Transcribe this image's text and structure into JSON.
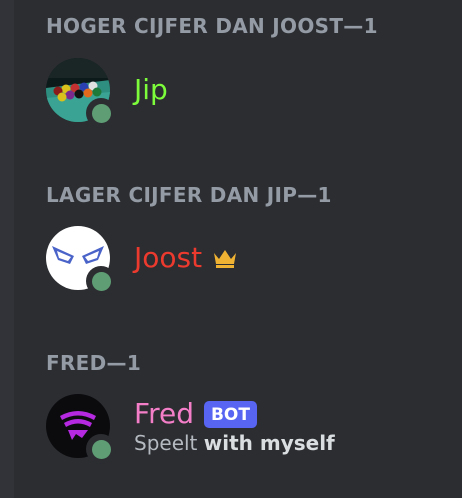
{
  "colors": {
    "background": "#2b2d31",
    "header_text": "#949ba4",
    "online_status": "#5f9d74",
    "jip_name": "#7cfc3a",
    "joost_name": "#ed3a2e",
    "fred_name": "#f47fc8",
    "bot_badge": "#5865f2",
    "crown": "#f0b232"
  },
  "groups": [
    {
      "header": "HOGER CIJFER DAN JOOST—1",
      "members": [
        {
          "name": "Jip",
          "avatar_icon": "billiard-balls-avatar",
          "status": "online"
        }
      ]
    },
    {
      "header": "LAGER CIJFER DAN JIP—1",
      "members": [
        {
          "name": "Joost",
          "avatar_icon": "angry-eyes-avatar",
          "status": "online",
          "badge_icon": "crown-icon"
        }
      ]
    },
    {
      "header": "FRED—1",
      "members": [
        {
          "name": "Fred",
          "avatar_icon": "purple-signal-avatar",
          "status": "online",
          "tag": "BOT",
          "activity_prefix": "Speelt",
          "activity_name": "with myself"
        }
      ]
    }
  ]
}
